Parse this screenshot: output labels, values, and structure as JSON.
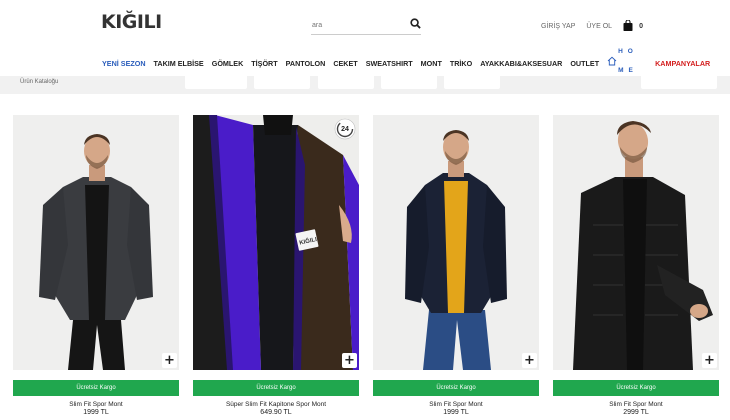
{
  "header": {
    "logo": "KIĞILI",
    "search_placeholder": "ara",
    "login": "GİRİŞ YAP",
    "signup": "ÜYE OL",
    "cart_count": "0"
  },
  "nav": {
    "items": [
      "YENİ SEZON",
      "TAKIM ELBİSE",
      "GÖMLEK",
      "TİŞÖRT",
      "PANTOLON",
      "CEKET",
      "SWEATSHIRT",
      "MONT",
      "TRİKO",
      "AYAKKABI&AKSESUAR",
      "OUTLET"
    ],
    "home_label": "HOME",
    "campaigns": "KAMPANYALAR",
    "active_color": "#2a5dbb",
    "campaign_color": "#d42020"
  },
  "filter": {
    "text": "Ürün Kataloğu"
  },
  "products": [
    {
      "shipping": "Ücretsiz Kargo",
      "name": "Slim Fit Spor Mont",
      "price": "1999 TL",
      "jacket_color": "#3a3c40",
      "shirt_color": "#141414",
      "pants_color": "#141414"
    },
    {
      "shipping": "Ücretsiz Kargo",
      "name": "Süper Slim Fit Kapitone Spor Mont",
      "price": "649.90 TL",
      "badge": "24"
    },
    {
      "shipping": "Ücretsiz Kargo",
      "name": "Slim Fit Spor Mont",
      "price": "1999 TL",
      "jacket_color": "#1b2235",
      "shirt_color": "#e3a51a",
      "pants_color": "#2b4d85"
    },
    {
      "shipping": "Ücretsiz Kargo",
      "name": "Slim Fit Spor Mont",
      "price": "2999 TL",
      "jacket_color": "#1a1a1a",
      "shirt_color": "#0f0f0f",
      "pants_color": "#1a1a1a"
    }
  ],
  "colors": {
    "shipping_green": "#20a74e"
  }
}
